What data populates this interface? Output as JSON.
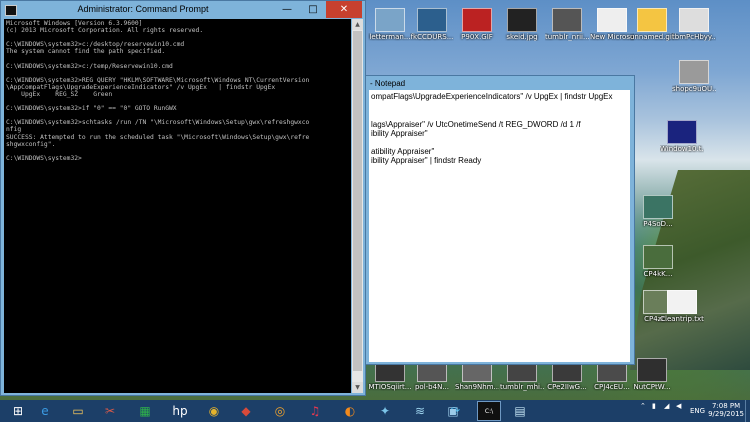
{
  "desktop_icons": [
    {
      "label": "letterman...",
      "color": "#7aa4c8"
    },
    {
      "label": "fkCCDURS...",
      "color": "#2c5f8d"
    },
    {
      "label": "P90X.GIF",
      "color": "#b22"
    },
    {
      "label": "skeid.jpg",
      "color": "#222"
    },
    {
      "label": "tumblr_nrii...",
      "color": "#555"
    },
    {
      "label": "New Microsoft...",
      "color": "#eee"
    },
    {
      "label": "unnamed.gif",
      "color": "#f4c542"
    },
    {
      "label": "tbmPcHbyy...",
      "color": "#ddd"
    },
    {
      "label": "shopc9uOU...",
      "color": "#9a9a9a"
    },
    {
      "label": "Window10.t...",
      "color": "#1a237e"
    },
    {
      "label": "P4SoD...",
      "color": "#3b7464"
    },
    {
      "label": "CP4kK...",
      "color": "#4a6d3d"
    },
    {
      "label": "CP4zc...",
      "color": "#6a7e5a"
    },
    {
      "label": "Cleantrip.txt",
      "color": "#f2f2f2"
    },
    {
      "label": "MTIOSqiirt...",
      "color": "#333"
    },
    {
      "label": "pol-b4N...",
      "color": "#555"
    },
    {
      "label": "Shan9Nhm...",
      "color": "#666"
    },
    {
      "label": "tumblr_mhi...",
      "color": "#444"
    },
    {
      "label": "CPe2IIwG...",
      "color": "#3a3a3a"
    },
    {
      "label": "CPJ4cEU...",
      "color": "#4b4b4b"
    },
    {
      "label": "NutCPtW...",
      "color": "#2f2f2f"
    }
  ],
  "cmd": {
    "title": "Administrator: Command Prompt",
    "min_label": "—",
    "max_label": "□",
    "close_label": "✕",
    "lines": [
      "Microsoft Windows [Version 6.3.9600]",
      "(c) 2013 Microsoft Corporation. All rights reserved.",
      "",
      "C:\\WINDOWS\\system32>c:/desktop/reservewin10.cmd",
      "The system cannot find the path specified.",
      "",
      "C:\\WINDOWS\\system32>c:/temp/Reservewin10.cmd",
      "",
      "C:\\WINDOWS\\system32>REG QUERY \"HKLM\\SOFTWARE\\Microsoft\\Windows NT\\CurrentVersion",
      "\\AppCompatFlags\\UpgradeExperienceIndicators\" /v UpgEx   | findstr UpgEx",
      "    UpgEx    REG_SZ    Green",
      "",
      "C:\\WINDOWS\\system32>if \"0\" == \"0\" GOTO RunGWX",
      "",
      "C:\\WINDOWS\\system32>schtasks /run /TN \"\\Microsoft\\Windows\\Setup\\gwx\\refreshgwxco",
      "nfig",
      "SUCCESS: Attempted to run the scheduled task \"\\Microsoft\\Windows\\Setup\\gwx\\refre",
      "shgwxconfig\".",
      "",
      "C:\\WINDOWS\\system32>"
    ]
  },
  "notepad": {
    "title": "- Notepad",
    "lines": [
      "ompatFlags\\UpgradeExperienceIndicators\" /v UpgEx | findstr UpgEx",
      "",
      "",
      "lags\\Appraiser\" /v UtcOnetimeSend /t REG_DWORD /d 1 /f",
      "ibility Appraiser\"",
      "",
      "atibility Appraiser\"",
      "ibility Appraiser\" | findstr Ready"
    ]
  },
  "taskbar": {
    "apps": [
      {
        "name": "windows-logo-icon",
        "glyph": "⊞",
        "color": "#ffffff"
      },
      {
        "name": "internet-explorer-icon",
        "glyph": "e",
        "color": "#3b9be3"
      },
      {
        "name": "file-explorer-icon",
        "glyph": "▭",
        "color": "#f2c55c"
      },
      {
        "name": "toolbox-app-icon",
        "glyph": "✂",
        "color": "#d75a4a"
      },
      {
        "name": "store-icon",
        "glyph": "▦",
        "color": "#2fb24a"
      },
      {
        "name": "hp-icon",
        "glyph": "hp",
        "color": "#ffffff"
      },
      {
        "name": "chrome-icon",
        "glyph": "◉",
        "color": "#e5b32c"
      },
      {
        "name": "red-app-icon",
        "glyph": "◆",
        "color": "#d84a3a"
      },
      {
        "name": "weibo-icon",
        "glyph": "◎",
        "color": "#f3a42c"
      },
      {
        "name": "itunes-icon",
        "glyph": "♫",
        "color": "#e8384f"
      },
      {
        "name": "firefox-icon",
        "glyph": "◐",
        "color": "#f28a1c"
      },
      {
        "name": "game-icon",
        "glyph": "✦",
        "color": "#7bc4e8"
      },
      {
        "name": "wifi-app-icon",
        "glyph": "≋",
        "color": "#9fd6f0"
      },
      {
        "name": "sync-icon",
        "glyph": "⟳",
        "color": "#3fb6e8"
      },
      {
        "name": "network-app-icon",
        "glyph": "▣",
        "color": "#9ccbe8"
      },
      {
        "name": "command-prompt-icon",
        "glyph": "C:\\",
        "color": "#ffffff"
      },
      {
        "name": "notepad-icon",
        "glyph": "▤",
        "color": "#bfe0f0"
      }
    ],
    "tray_lang": "ENG",
    "time": "7:08 PM",
    "date": "9/29/2015"
  }
}
